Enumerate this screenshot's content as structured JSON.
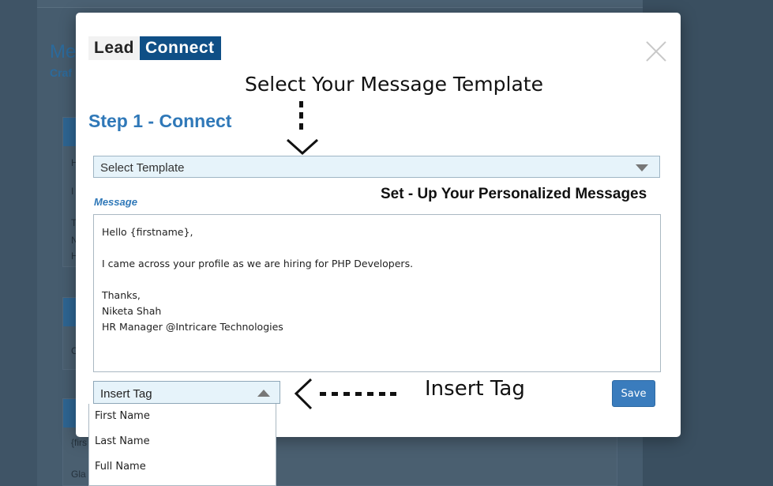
{
  "background": {
    "title_fragment": "Me",
    "subtitle_fragment": "Craf",
    "snippets": [
      "H",
      "I",
      "T",
      "N",
      "H",
      "C",
      "{firs",
      "Gla"
    ]
  },
  "modal": {
    "logo": {
      "lead": "Lead",
      "connect": "Connect"
    },
    "annotations": {
      "select_template": "Select Your Message Template",
      "personalize": "Set - Up Your Personalized Messages",
      "insert_tag": "Insert Tag"
    },
    "step_title": "Step 1 - Connect",
    "template_select": {
      "value": "Select Template"
    },
    "message_label": "Message",
    "message_lines": {
      "greeting": "Hello {firstname},",
      "body": "I came across your profile as we are hiring for PHP Developers.",
      "thanks": "Thanks,",
      "name": "Niketa Shah",
      "title": "HR Manager @Intricare Technologies"
    },
    "insert_tag": {
      "value": "Insert Tag",
      "options": [
        "First Name",
        "Last Name",
        "Full Name"
      ]
    },
    "save_label": "Save"
  },
  "colors": {
    "brand": "#0f4f86",
    "accent": "#2f78b8",
    "save_button": "#3a7cbd",
    "overlay": "#3f5466"
  },
  "icons": [
    "close-icon",
    "chevron-down-icon",
    "chevron-up-icon",
    "arrow-down-annotation",
    "arrow-left-annotation"
  ]
}
